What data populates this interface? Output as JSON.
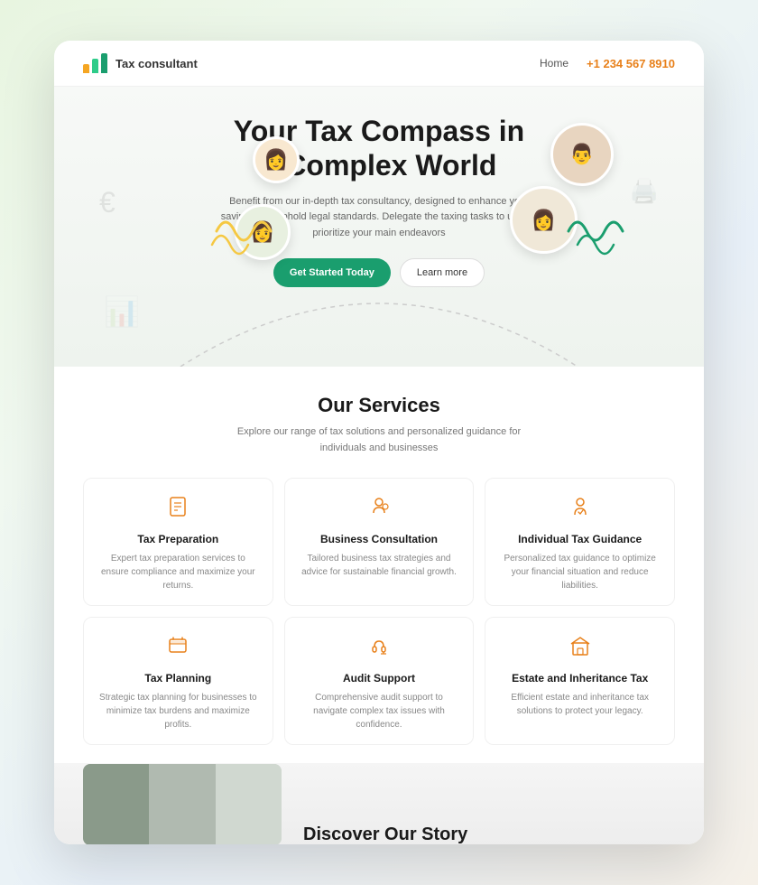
{
  "nav": {
    "logo_text": "Tax consultant",
    "links": [
      {
        "label": "Home",
        "href": "#"
      }
    ],
    "phone": "+1 234 567 8910"
  },
  "hero": {
    "title_line1": "Your Tax Compass in",
    "title_line2": "a Complex World",
    "subtitle": "Benefit from our in-depth tax consultancy, designed to enhance your savings and uphold legal standards. Delegate the taxing tasks to us and prioritize your main endeavors",
    "btn_primary": "Get Started Today",
    "btn_secondary": "Learn more",
    "avatars": [
      {
        "emoji": "👩"
      },
      {
        "emoji": "👨"
      },
      {
        "emoji": "👩"
      },
      {
        "emoji": "👩"
      }
    ]
  },
  "services": {
    "title": "Our Services",
    "subtitle": "Explore our range of tax solutions and personalized guidance for individuals and businesses",
    "items": [
      {
        "icon": "📋",
        "name": "Tax Preparation",
        "desc": "Expert tax preparation services to ensure compliance and maximize your returns."
      },
      {
        "icon": "💼",
        "name": "Business Consultation",
        "desc": "Tailored business tax strategies and advice for sustainable financial growth."
      },
      {
        "icon": "👤",
        "name": "Individual Tax Guidance",
        "desc": "Personalized tax guidance to optimize your financial situation and reduce liabilities."
      },
      {
        "icon": "📚",
        "name": "Tax Planning",
        "desc": "Strategic tax planning for businesses to minimize tax burdens and maximize profits."
      },
      {
        "icon": "🎧",
        "name": "Audit Support",
        "desc": "Comprehensive audit support to navigate complex tax issues with confidence."
      },
      {
        "icon": "🏛️",
        "name": "Estate and Inheritance Tax",
        "desc": "Efficient estate and inheritance tax solutions to protect your legacy."
      }
    ]
  },
  "story": {
    "title": "Discover Our Story"
  }
}
